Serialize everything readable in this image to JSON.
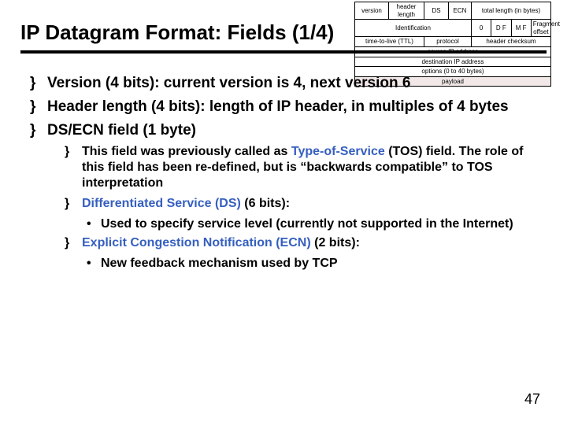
{
  "title": "IP Datagram Format: Fields (1/4)",
  "bullets": [
    {
      "prefix": "Version (4 bits):",
      "rest": " current version is 4, next version 6"
    },
    {
      "prefix": "Header length (4 bits):",
      "rest": " length of IP header, in multiples of 4 bytes"
    },
    {
      "prefix": "DS/ECN field (1 byte)",
      "rest": ""
    }
  ],
  "sub": [
    {
      "plain_a": "This field was previously called as ",
      "blue": "Type-of-Service",
      "plain_b": " (TOS) field. The role of this field has been re-defined, but is “backwards compatible” to TOS interpretation"
    },
    {
      "plain_a": "",
      "blue": "Differentiated Service (DS)",
      "plain_b": " (6 bits):"
    },
    {
      "plain_a": "",
      "blue": "Explicit Congestion Notification (ECN)",
      "plain_b": " (2 bits):"
    }
  ],
  "subsub": {
    "ds": "Used to specify service level (currently not supported in the Internet)",
    "ecn": "New feedback mechanism used by TCP"
  },
  "page": "47",
  "marker1": "}",
  "marker2": "•",
  "diagram": {
    "r1c1": "version",
    "r1c2": "header length",
    "r1c3": "DS",
    "r1c4": "ECN",
    "r1c5": "total length (in bytes)",
    "r2c1": "Identification",
    "r2c2": "0",
    "r2c3": "D F",
    "r2c4": "M F",
    "r2c5": "Fragment offset",
    "r3c1": "time-to-live (TTL)",
    "r3c2": "protocol",
    "r3c3": "header checksum",
    "r4": "source IP address",
    "r5": "destination IP address",
    "r6": "options (0 to 40 bytes)",
    "r7": "payload"
  }
}
